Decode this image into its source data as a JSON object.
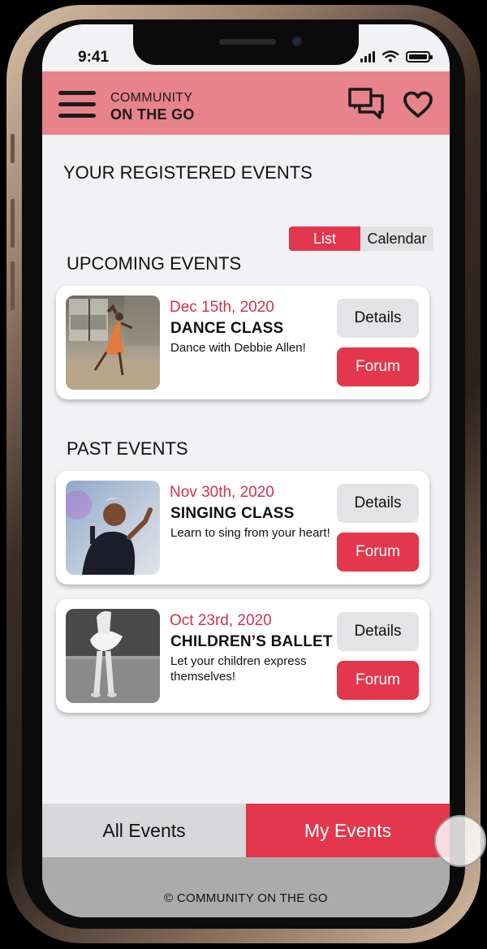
{
  "status_bar": {
    "time": "9:41"
  },
  "header": {
    "brand_line1": "COMMUNITY",
    "brand_line2": "ON THE GO",
    "icons": [
      "menu-icon",
      "chat-icon",
      "heart-icon"
    ]
  },
  "page": {
    "title": "YOUR REGISTERED EVENTS",
    "view_toggle": {
      "list_label": "List",
      "calendar_label": "Calendar",
      "selected": "List"
    }
  },
  "upcoming": {
    "title": "UPCOMING EVENTS",
    "events": [
      {
        "date": "Dec 15th, 2020",
        "name": "DANCE CLASS",
        "description": "Dance with Debbie Allen!",
        "details_label": "Details",
        "forum_label": "Forum"
      }
    ]
  },
  "past": {
    "title": "PAST EVENTS",
    "events": [
      {
        "date": "Nov 30th, 2020",
        "name": "SINGING CLASS",
        "description": "Learn to sing from your heart!",
        "details_label": "Details",
        "forum_label": "Forum"
      },
      {
        "date": "Oct 23rd, 2020",
        "name": "CHILDREN’S BALLET",
        "description": "Let your children express themselves!",
        "details_label": "Details",
        "forum_label": "Forum"
      }
    ]
  },
  "bottom_tabs": {
    "all_label": "All Events",
    "my_label": "My Events",
    "active": "My Events"
  },
  "footer": {
    "text": "© COMMUNITY ON THE GO"
  },
  "colors": {
    "accent": "#e2374c",
    "header": "#e8838c",
    "date": "#d1314c",
    "background": "#f2f1f4"
  }
}
